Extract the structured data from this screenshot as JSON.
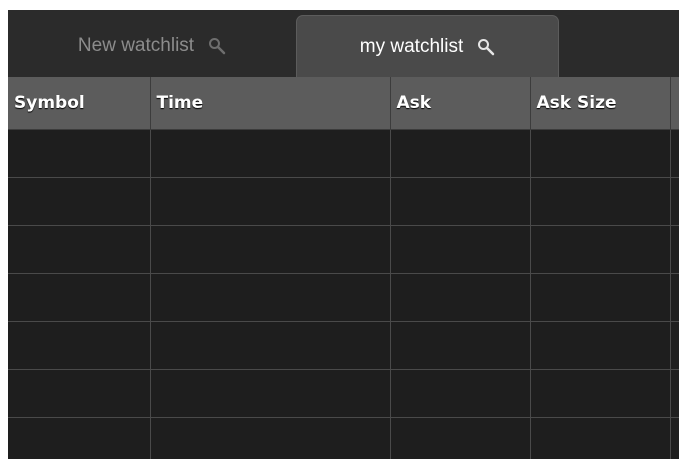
{
  "tabs": [
    {
      "label": "New watchlist",
      "icon": "search-icon",
      "active": false
    },
    {
      "label": "my watchlist",
      "icon": "search-icon",
      "active": true
    }
  ],
  "table": {
    "columns": [
      "Symbol",
      "Time",
      "Ask",
      "Ask Size",
      ""
    ],
    "rows": [
      [
        "",
        "",
        "",
        "",
        ""
      ],
      [
        "",
        "",
        "",
        "",
        ""
      ],
      [
        "",
        "",
        "",
        "",
        ""
      ],
      [
        "",
        "",
        "",
        "",
        ""
      ],
      [
        "",
        "",
        "",
        "",
        ""
      ],
      [
        "",
        "",
        "",
        "",
        ""
      ],
      [
        "",
        "",
        "",
        "",
        ""
      ]
    ]
  },
  "colors": {
    "background": "#2b2b2b",
    "active_tab": "#4a4a4a",
    "header": "#5c5c5c",
    "grid_cell": "#1e1e1e",
    "grid_line": "#4a4a4a",
    "inactive_text": "#8c8c8c",
    "active_text": "#ffffff"
  }
}
